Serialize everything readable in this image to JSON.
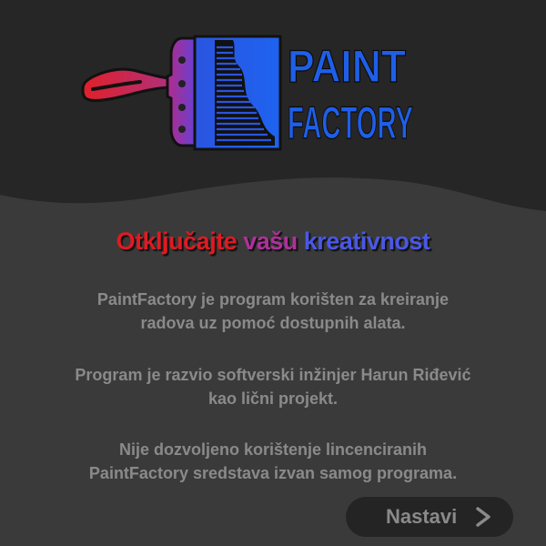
{
  "brand": {
    "line1": "PAINT",
    "line2": "FACTORY"
  },
  "headline": {
    "word1": "Otključajte",
    "word2": "vašu",
    "word3": "kreativnost"
  },
  "paragraphs": [
    {
      "line1": "PaintFactory je program korišten za kreiranje",
      "line2": "radova uz pomoć dostupnih alata."
    },
    {
      "line1": "Program je razvio softverski inžinjer Harun Riđević",
      "line2": "kao lični projekt."
    },
    {
      "line1": "Nije dozvoljeno korištenje lincenciranih",
      "line2": "PaintFactory sredstava izvan samog programa."
    }
  ],
  "continue_button": {
    "label": "Nastavi",
    "icon": "chevron-right-icon"
  },
  "colors": {
    "background": "#3a3a3a",
    "header_background": "#262626",
    "accent_red": "#e01a22",
    "accent_purple": "#b0309c",
    "accent_blue": "#1f5fe0",
    "muted_text": "#8a8a8a"
  }
}
